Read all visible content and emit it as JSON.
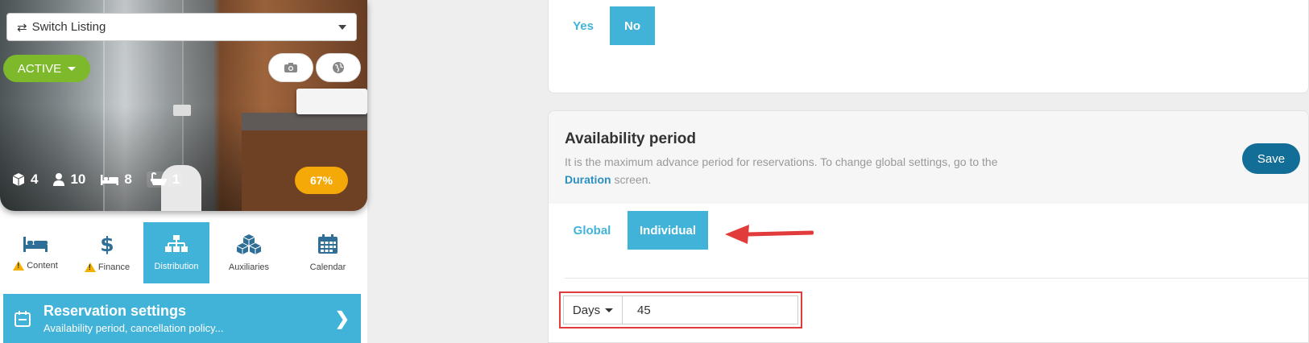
{
  "listing": {
    "switch_label": "Switch Listing",
    "status_label": "ACTIVE",
    "stats": {
      "rooms": "4",
      "guests": "10",
      "beds": "8",
      "bathrooms": "1"
    },
    "completion": "67%"
  },
  "tabs": [
    {
      "label": "Content",
      "icon": "bed-icon",
      "warning": true
    },
    {
      "label": "Finance",
      "icon": "dollar-icon",
      "warning": true
    },
    {
      "label": "Distribution",
      "icon": "sitemap-icon",
      "warning": false,
      "active": true
    },
    {
      "label": "Auxiliaries",
      "icon": "cubes-icon",
      "warning": false
    },
    {
      "label": "Calendar",
      "icon": "calendar-icon",
      "warning": false
    }
  ],
  "reservation_settings": {
    "title": "Reservation settings",
    "subtitle": "Availability period, cancellation policy..."
  },
  "top_toggle": {
    "yes": "Yes",
    "no": "No",
    "selected": "No"
  },
  "availability": {
    "title": "Availability period",
    "desc_prefix": "It is the maximum advance period for reservations. To change global settings, go to the",
    "desc_link": "Duration",
    "desc_suffix": "screen.",
    "save_label": "Save",
    "mode_global": "Global",
    "mode_individual": "Individual",
    "selected_mode": "Individual",
    "unit_label": "Days",
    "value": "45"
  },
  "colors": {
    "accent": "#42b3d8",
    "save": "#126e97",
    "active_green": "#7db92b",
    "badge_orange": "#f4a908",
    "highlight_red": "#e23b3b"
  }
}
